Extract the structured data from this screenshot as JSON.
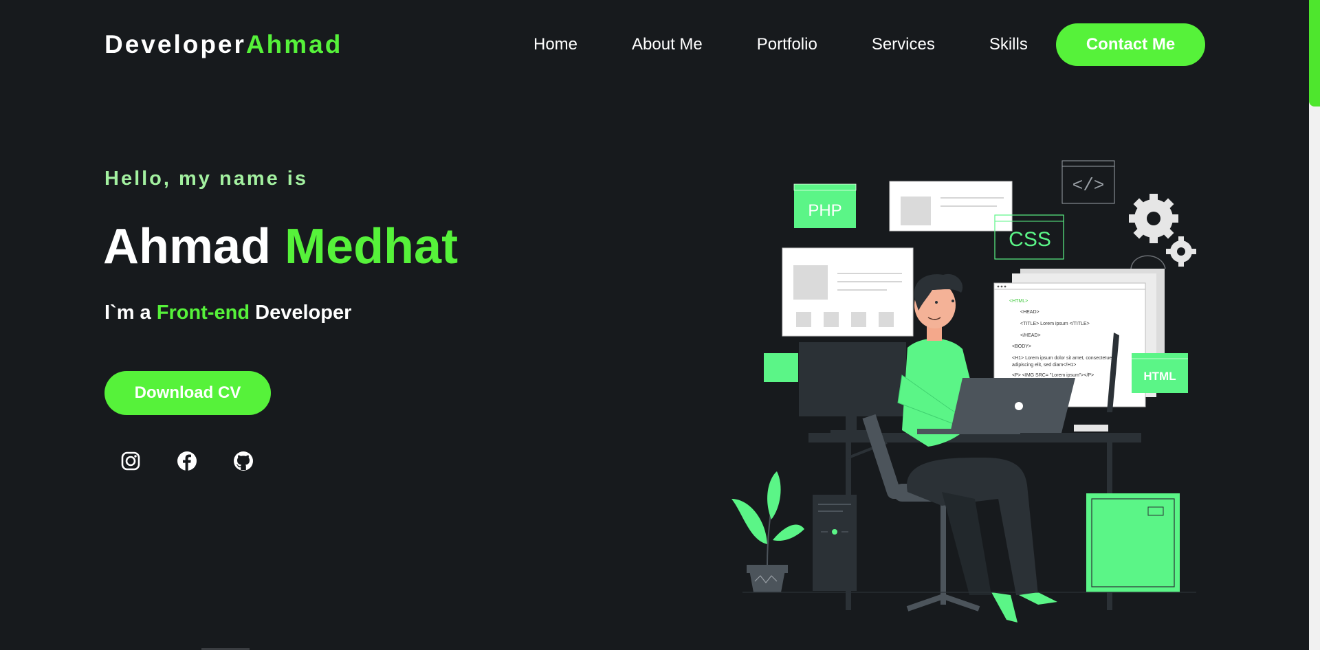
{
  "header": {
    "logo_main": "Developer",
    "logo_accent": "Ahmad",
    "nav": [
      "Home",
      "About Me",
      "Portfolio",
      "Services",
      "Skills"
    ],
    "contact_label": "Contact Me"
  },
  "hero": {
    "greeting": "Hello, my name is",
    "first_name": "Ahmad",
    "last_name": "Medhat",
    "role_prefix": "I`m a",
    "role_accent": "Front-end",
    "role_suffix": "Developer",
    "cv_label": "Download CV",
    "socials": [
      "instagram-icon",
      "facebook-icon",
      "github-icon"
    ]
  },
  "illustration": {
    "php": "PHP",
    "css": "CSS",
    "html": "HTML",
    "code_tag": "</>",
    "code_lines": [
      "<HTML>",
      "<HEAD>",
      "<TITLE> Lorem ipsum </TITLE>",
      "</HEAD>",
      "<BODY>",
      "<H1> Lorem ipsum dolor sit amet, consectetuer",
      "adipiscing elit, sed diam</H1>",
      "<P> <IMG SRC= \"Lorem ipsum\"></P>"
    ]
  },
  "colors": {
    "background": "#171a1d",
    "accent": "#56f23a",
    "greeting": "#a3f0a0",
    "illustration_green": "#5bf587"
  }
}
